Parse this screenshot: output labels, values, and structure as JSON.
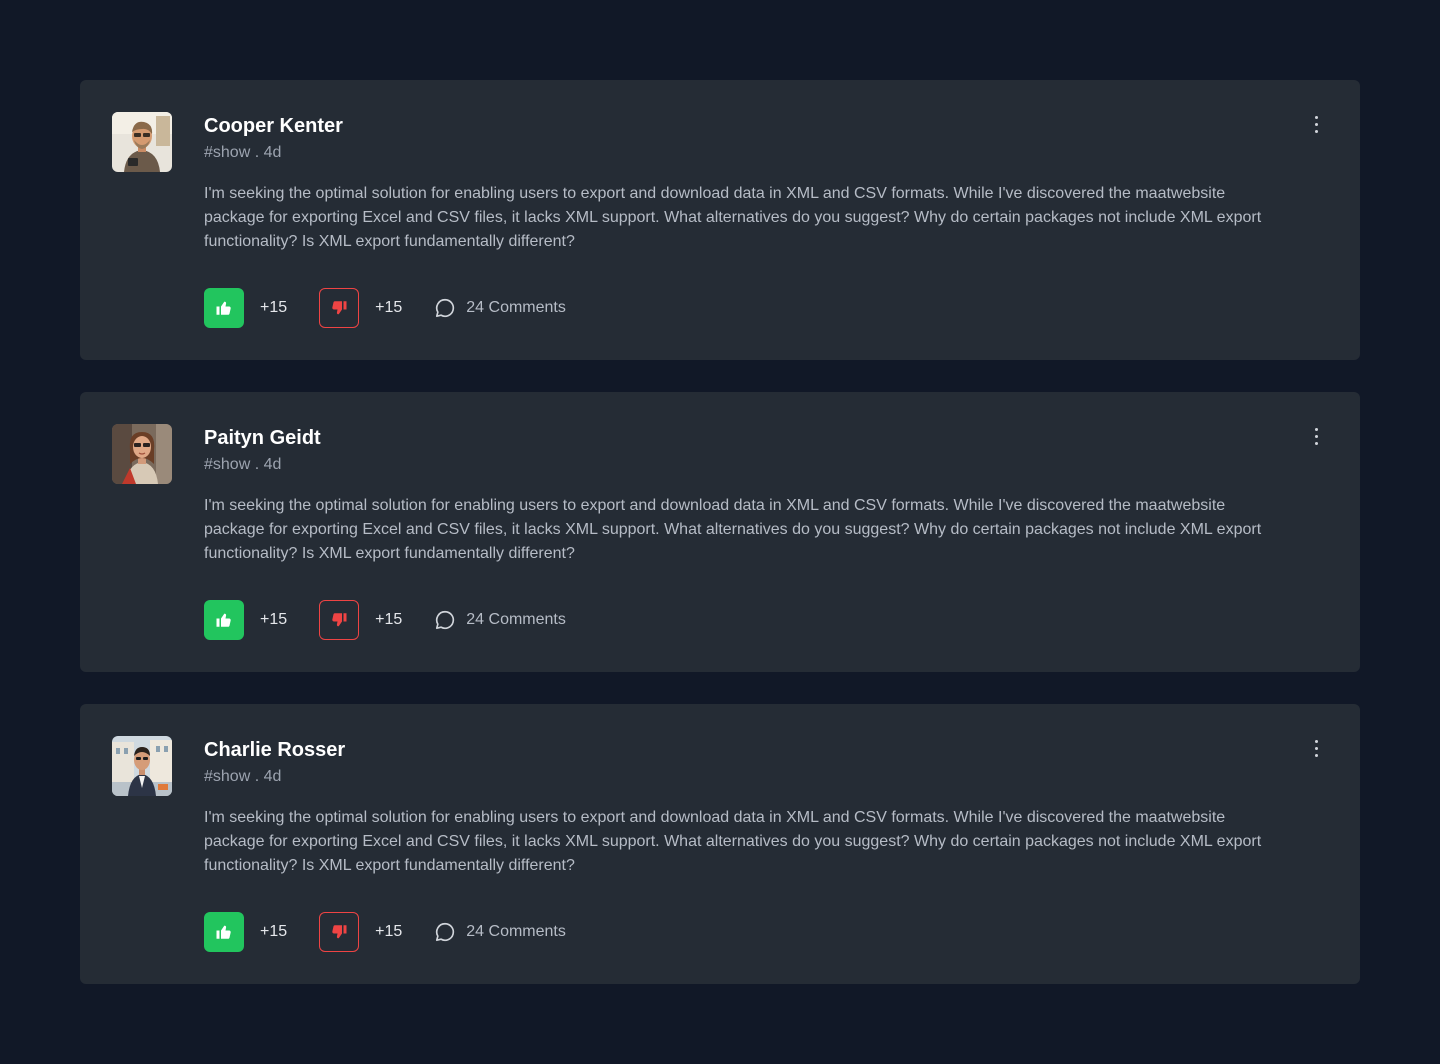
{
  "colors": {
    "page_bg": "#111827",
    "card_bg": "#252c35",
    "like": "#22c55e",
    "dislike": "#ef4444"
  },
  "posts": [
    {
      "author": "Cooper Kenter",
      "meta": "#show . 4d",
      "body": "I'm seeking the optimal solution for enabling users to export and download data in XML and CSV formats. While I've discovered the maatwebsite package for exporting Excel and CSV files, it lacks XML support. What alternatives do you suggest? Why do certain packages not include XML export functionality? Is XML export fundamentally different?",
      "likes": "+15",
      "dislikes": "+15",
      "comments": "24 Comments"
    },
    {
      "author": "Paityn Geidt",
      "meta": "#show . 4d",
      "body": "I'm seeking the optimal solution for enabling users to export and download data in XML and CSV formats. While I've discovered the maatwebsite package for exporting Excel and CSV files, it lacks XML support. What alternatives do you suggest? Why do certain packages not include XML export functionality? Is XML export fundamentally different?",
      "likes": "+15",
      "dislikes": "+15",
      "comments": "24 Comments"
    },
    {
      "author": "Charlie Rosser",
      "meta": "#show . 4d",
      "body": "I'm seeking the optimal solution for enabling users to export and download data in XML and CSV formats. While I've discovered the maatwebsite package for exporting Excel and CSV files, it lacks XML support. What alternatives do you suggest? Why do certain packages not include XML export functionality? Is XML export fundamentally different?",
      "likes": "+15",
      "dislikes": "+15",
      "comments": "24 Comments"
    }
  ]
}
